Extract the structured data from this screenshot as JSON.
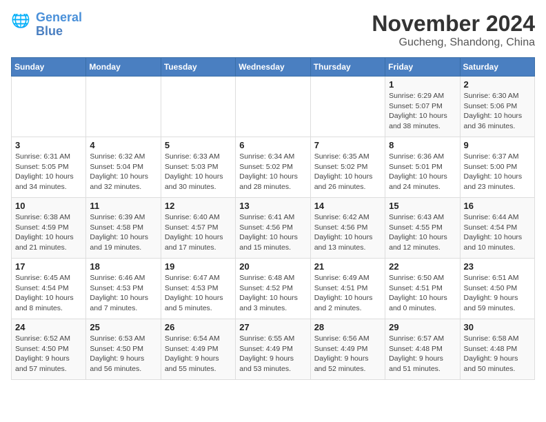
{
  "header": {
    "logo_line1": "General",
    "logo_line2": "Blue",
    "month": "November 2024",
    "location": "Gucheng, Shandong, China"
  },
  "weekdays": [
    "Sunday",
    "Monday",
    "Tuesday",
    "Wednesday",
    "Thursday",
    "Friday",
    "Saturday"
  ],
  "weeks": [
    [
      {
        "day": "",
        "info": ""
      },
      {
        "day": "",
        "info": ""
      },
      {
        "day": "",
        "info": ""
      },
      {
        "day": "",
        "info": ""
      },
      {
        "day": "",
        "info": ""
      },
      {
        "day": "1",
        "info": "Sunrise: 6:29 AM\nSunset: 5:07 PM\nDaylight: 10 hours and 38 minutes."
      },
      {
        "day": "2",
        "info": "Sunrise: 6:30 AM\nSunset: 5:06 PM\nDaylight: 10 hours and 36 minutes."
      }
    ],
    [
      {
        "day": "3",
        "info": "Sunrise: 6:31 AM\nSunset: 5:05 PM\nDaylight: 10 hours and 34 minutes."
      },
      {
        "day": "4",
        "info": "Sunrise: 6:32 AM\nSunset: 5:04 PM\nDaylight: 10 hours and 32 minutes."
      },
      {
        "day": "5",
        "info": "Sunrise: 6:33 AM\nSunset: 5:03 PM\nDaylight: 10 hours and 30 minutes."
      },
      {
        "day": "6",
        "info": "Sunrise: 6:34 AM\nSunset: 5:02 PM\nDaylight: 10 hours and 28 minutes."
      },
      {
        "day": "7",
        "info": "Sunrise: 6:35 AM\nSunset: 5:02 PM\nDaylight: 10 hours and 26 minutes."
      },
      {
        "day": "8",
        "info": "Sunrise: 6:36 AM\nSunset: 5:01 PM\nDaylight: 10 hours and 24 minutes."
      },
      {
        "day": "9",
        "info": "Sunrise: 6:37 AM\nSunset: 5:00 PM\nDaylight: 10 hours and 23 minutes."
      }
    ],
    [
      {
        "day": "10",
        "info": "Sunrise: 6:38 AM\nSunset: 4:59 PM\nDaylight: 10 hours and 21 minutes."
      },
      {
        "day": "11",
        "info": "Sunrise: 6:39 AM\nSunset: 4:58 PM\nDaylight: 10 hours and 19 minutes."
      },
      {
        "day": "12",
        "info": "Sunrise: 6:40 AM\nSunset: 4:57 PM\nDaylight: 10 hours and 17 minutes."
      },
      {
        "day": "13",
        "info": "Sunrise: 6:41 AM\nSunset: 4:56 PM\nDaylight: 10 hours and 15 minutes."
      },
      {
        "day": "14",
        "info": "Sunrise: 6:42 AM\nSunset: 4:56 PM\nDaylight: 10 hours and 13 minutes."
      },
      {
        "day": "15",
        "info": "Sunrise: 6:43 AM\nSunset: 4:55 PM\nDaylight: 10 hours and 12 minutes."
      },
      {
        "day": "16",
        "info": "Sunrise: 6:44 AM\nSunset: 4:54 PM\nDaylight: 10 hours and 10 minutes."
      }
    ],
    [
      {
        "day": "17",
        "info": "Sunrise: 6:45 AM\nSunset: 4:54 PM\nDaylight: 10 hours and 8 minutes."
      },
      {
        "day": "18",
        "info": "Sunrise: 6:46 AM\nSunset: 4:53 PM\nDaylight: 10 hours and 7 minutes."
      },
      {
        "day": "19",
        "info": "Sunrise: 6:47 AM\nSunset: 4:53 PM\nDaylight: 10 hours and 5 minutes."
      },
      {
        "day": "20",
        "info": "Sunrise: 6:48 AM\nSunset: 4:52 PM\nDaylight: 10 hours and 3 minutes."
      },
      {
        "day": "21",
        "info": "Sunrise: 6:49 AM\nSunset: 4:51 PM\nDaylight: 10 hours and 2 minutes."
      },
      {
        "day": "22",
        "info": "Sunrise: 6:50 AM\nSunset: 4:51 PM\nDaylight: 10 hours and 0 minutes."
      },
      {
        "day": "23",
        "info": "Sunrise: 6:51 AM\nSunset: 4:50 PM\nDaylight: 9 hours and 59 minutes."
      }
    ],
    [
      {
        "day": "24",
        "info": "Sunrise: 6:52 AM\nSunset: 4:50 PM\nDaylight: 9 hours and 57 minutes."
      },
      {
        "day": "25",
        "info": "Sunrise: 6:53 AM\nSunset: 4:50 PM\nDaylight: 9 hours and 56 minutes."
      },
      {
        "day": "26",
        "info": "Sunrise: 6:54 AM\nSunset: 4:49 PM\nDaylight: 9 hours and 55 minutes."
      },
      {
        "day": "27",
        "info": "Sunrise: 6:55 AM\nSunset: 4:49 PM\nDaylight: 9 hours and 53 minutes."
      },
      {
        "day": "28",
        "info": "Sunrise: 6:56 AM\nSunset: 4:49 PM\nDaylight: 9 hours and 52 minutes."
      },
      {
        "day": "29",
        "info": "Sunrise: 6:57 AM\nSunset: 4:48 PM\nDaylight: 9 hours and 51 minutes."
      },
      {
        "day": "30",
        "info": "Sunrise: 6:58 AM\nSunset: 4:48 PM\nDaylight: 9 hours and 50 minutes."
      }
    ]
  ]
}
